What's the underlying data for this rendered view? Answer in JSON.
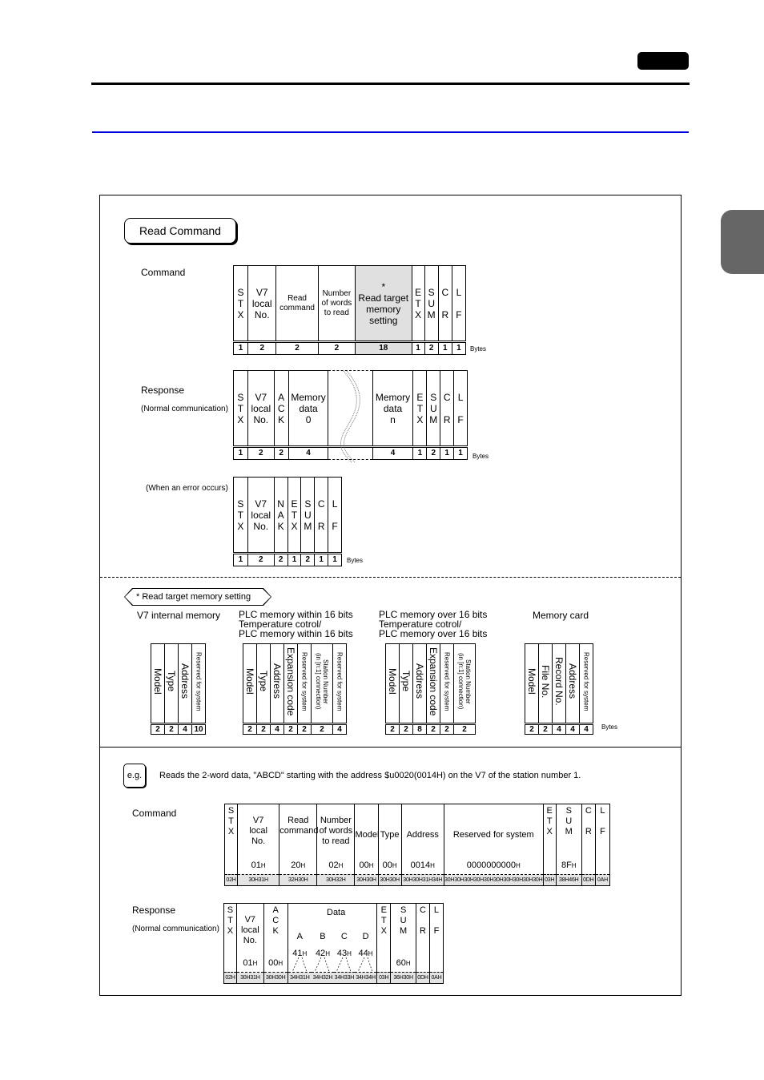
{
  "read_command_label": "Read Command",
  "bytes_label": "Bytes",
  "command_frame": {
    "label": "Command",
    "fields": [
      {
        "name": "S\nT\nX",
        "bytes": "1"
      },
      {
        "name": "V7\nlocal\nNo.",
        "bytes": "2"
      },
      {
        "name": "Read\ncommand",
        "bytes": "2"
      },
      {
        "name": "Number\nof words\nto read",
        "bytes": "2"
      },
      {
        "name": "*\nRead target\nmemory\nsetting",
        "bytes": "18"
      },
      {
        "name": "E\nT\nX",
        "bytes": "1"
      },
      {
        "name": "S\nU\nM",
        "bytes": "2"
      },
      {
        "name": "C\n\nR",
        "bytes": "1"
      },
      {
        "name": "L\n\nF",
        "bytes": "1"
      }
    ]
  },
  "response_frame": {
    "label": "Response",
    "sublabel": "(Normal communication)",
    "fields": [
      {
        "name": "S\nT\nX",
        "bytes": "1"
      },
      {
        "name": "V7\nlocal\nNo.",
        "bytes": "2"
      },
      {
        "name": "A\nC\nK",
        "bytes": "2"
      },
      {
        "name": "Memory\ndata\n0",
        "bytes": "4"
      },
      {
        "name": "",
        "bytes": ""
      },
      {
        "name": "Memory\ndata\nn",
        "bytes": "4"
      },
      {
        "name": "E\nT\nX",
        "bytes": "1"
      },
      {
        "name": "S\nU\nM",
        "bytes": "2"
      },
      {
        "name": "C\n\nR",
        "bytes": "1"
      },
      {
        "name": "L\n\nF",
        "bytes": "1"
      }
    ]
  },
  "error_frame": {
    "label": "(When an error occurs)",
    "fields": [
      {
        "name": "S\nT\nX",
        "bytes": "1"
      },
      {
        "name": "V7\nlocal\nNo.",
        "bytes": "2"
      },
      {
        "name": "N\nA\nK",
        "bytes": "2"
      },
      {
        "name": "E\nT\nX",
        "bytes": "1"
      },
      {
        "name": "S\nU\nM",
        "bytes": "2"
      },
      {
        "name": "C\n\nR",
        "bytes": "1"
      },
      {
        "name": "L\n\nF",
        "bytes": "1"
      }
    ]
  },
  "memory_setting": {
    "title": "* Read target memory setting",
    "groups": [
      {
        "heading": "V7 internal memory",
        "fields": [
          {
            "name": "Model",
            "bytes": "2"
          },
          {
            "name": "Type",
            "bytes": "2"
          },
          {
            "name": "Address",
            "bytes": "4"
          },
          {
            "name": "Reserved for system",
            "bytes": "10",
            "small": true
          }
        ]
      },
      {
        "heading": "PLC memory within 16 bits\nTemperature cotrol/\nPLC memory within 16 bits",
        "fields": [
          {
            "name": "Model",
            "bytes": "2"
          },
          {
            "name": "Type",
            "bytes": "2"
          },
          {
            "name": "Address",
            "bytes": "4"
          },
          {
            "name": "Expansion code",
            "bytes": "2"
          },
          {
            "name": "Reserved for system",
            "bytes": "2",
            "small": true
          },
          {
            "name": "Station Number\n(in [n:1] connection)",
            "bytes": "2",
            "small": true
          },
          {
            "name": "Reserved for system",
            "bytes": "4",
            "small": true
          }
        ]
      },
      {
        "heading": "PLC memory over 16 bits\nTemperature cotrol/\nPLC memory over 16 bits",
        "fields": [
          {
            "name": "Model",
            "bytes": "2"
          },
          {
            "name": "Type",
            "bytes": "2"
          },
          {
            "name": "Address",
            "bytes": "8"
          },
          {
            "name": "Expansion code",
            "bytes": "2"
          },
          {
            "name": "Reserved for system",
            "bytes": "2",
            "small": true
          },
          {
            "name": "Station Number\n(in [n:1] connection)",
            "bytes": "2",
            "small": true
          }
        ]
      },
      {
        "heading": "Memory card",
        "fields": [
          {
            "name": "Model",
            "bytes": "2"
          },
          {
            "name": "File No.",
            "bytes": "2"
          },
          {
            "name": "Record No.",
            "bytes": "4"
          },
          {
            "name": "Address",
            "bytes": "4"
          },
          {
            "name": "Reserved for system",
            "bytes": "4",
            "small": true
          }
        ]
      }
    ]
  },
  "example": {
    "badge": "e.g.",
    "description": "Reads the 2-word data, \"ABCD\" starting with the address $u0020(0014H) on the V7 of the station number 1.",
    "command": {
      "label": "Command",
      "fields": [
        {
          "name": "S\nT\nX",
          "value": "",
          "hex": "02H"
        },
        {
          "name": "V7\nlocal\nNo.",
          "value": "01H",
          "hex": "30H31H"
        },
        {
          "name": "Read\ncommand",
          "value": "20H",
          "hex": "32H30H"
        },
        {
          "name": "Number\nof words\nto read",
          "value": "02H",
          "hex": "30H32H"
        },
        {
          "name": "Model",
          "value": "00H",
          "hex": "30H30H"
        },
        {
          "name": "Type",
          "value": "00H",
          "hex": "30H30H"
        },
        {
          "name": "Address",
          "value": "0014H",
          "hex": "30H30H31H34H"
        },
        {
          "name": "Reserved for system",
          "value": "0000000000H",
          "hex": "30H30H30H30H30H30H30H30H30H30H"
        },
        {
          "name": "E\nT\nX",
          "value": "",
          "hex": "03H"
        },
        {
          "name": "S\nU\nM",
          "value": "8FH",
          "hex": "38H46H"
        },
        {
          "name": "C\n\nR",
          "value": "",
          "hex": "0DH"
        },
        {
          "name": "L\n\nF",
          "value": "",
          "hex": "0AH"
        }
      ]
    },
    "response": {
      "label": "Response",
      "sublabel": "(Normal communication)",
      "data_label": "Data",
      "fields": [
        {
          "name": "S\nT\nX",
          "value": "",
          "hex": "02H"
        },
        {
          "name": "V7\nlocal\nNo.",
          "value": "01H",
          "hex": "30H31H"
        },
        {
          "name": "A\nC\nK",
          "value": "00H",
          "hex": "30H30H"
        },
        {
          "name": "A",
          "value": "41H",
          "hex": "34H31H",
          "data": true
        },
        {
          "name": "B",
          "value": "42H",
          "hex": "34H32H",
          "data": true
        },
        {
          "name": "C",
          "value": "43H",
          "hex": "34H33H",
          "data": true
        },
        {
          "name": "D",
          "value": "44H",
          "hex": "34H34H",
          "data": true
        },
        {
          "name": "E\nT\nX",
          "value": "",
          "hex": "03H"
        },
        {
          "name": "S\nU\nM",
          "value": "60H",
          "hex": "36H30H"
        },
        {
          "name": "C\n\nR",
          "value": "",
          "hex": "0DH"
        },
        {
          "name": "L\n\nF",
          "value": "",
          "hex": "0AH"
        }
      ]
    }
  },
  "colors": {
    "header_rule": "#000000",
    "section_rule": "#0000dd",
    "side_tab": "#666666",
    "highlight_cell": "#e0e0e0"
  }
}
